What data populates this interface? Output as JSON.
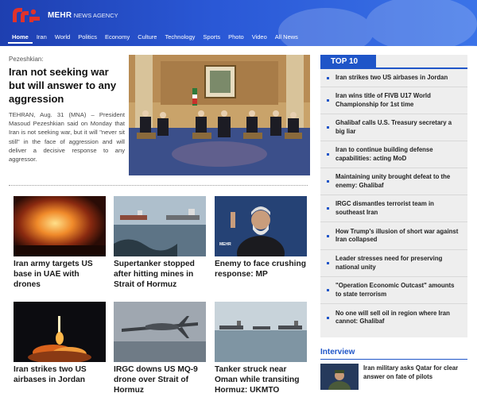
{
  "header": {
    "logo_primary": "MEHR",
    "logo_secondary": "NEWS AGENCY",
    "nav": [
      {
        "label": "Home",
        "active": true
      },
      {
        "label": "Iran",
        "active": false
      },
      {
        "label": "World",
        "active": false
      },
      {
        "label": "Politics",
        "active": false
      },
      {
        "label": "Economy",
        "active": false
      },
      {
        "label": "Culture",
        "active": false
      },
      {
        "label": "Technology",
        "active": false
      },
      {
        "label": "Sports",
        "active": false
      },
      {
        "label": "Photo",
        "active": false
      },
      {
        "label": "Video",
        "active": false
      },
      {
        "label": "All News",
        "active": false
      }
    ]
  },
  "lead": {
    "kicker": "Pezeshkian:",
    "title": "Iran not seeking war but will answer to any aggression",
    "lede": "TEHRAN, Aug. 31 (MNA) – President Masoud Pezeshkian said on Monday that Iran is not seeking war, but it will \"never sit still\" in the face of aggression and will deliver a decisive response to any aggressor."
  },
  "cards": [
    {
      "title": "Iran army targets US base in UAE with drones"
    },
    {
      "title": "Supertanker stopped after hitting mines in Strait of Hormuz"
    },
    {
      "title": "Enemy to face crushing response: MP"
    },
    {
      "title": "Iran strikes two US airbases in Jordan"
    },
    {
      "title": "IRGC downs US MQ-9 drone over Strait of Hormuz"
    },
    {
      "title": "Tanker struck near Oman while transiting Hormuz: UKMTO"
    }
  ],
  "top10": {
    "heading": "TOP 10",
    "items": [
      "Iran strikes two US airbases in Jordan",
      "Iran wins title of FIVB U17 World Championship for 1st time",
      "Ghalibaf calls U.S. Treasury secretary a big liar",
      "Iran to continue building defense capabilities: acting MoD",
      "Maintaining unity brought defeat to the enemy: Ghalibaf",
      "IRGC dismantles terrorist team in southeast Iran",
      "How Trump's illusion of short war against Iran collapsed",
      "Leader stresses need for preserving national unity",
      "\"Operation Economic Outcast\" amounts to state terrorism",
      "No one will sell oil in region where Iran cannot: Ghalibaf"
    ]
  },
  "interview": {
    "heading": "Interview",
    "title": "Iran military asks Qatar for clear answer on fate of pilots"
  },
  "photo_watermark": "MEHR",
  "colors": {
    "brand": "#1f55c8",
    "header": "#2a58d6",
    "logo_red": "#e0322b"
  }
}
